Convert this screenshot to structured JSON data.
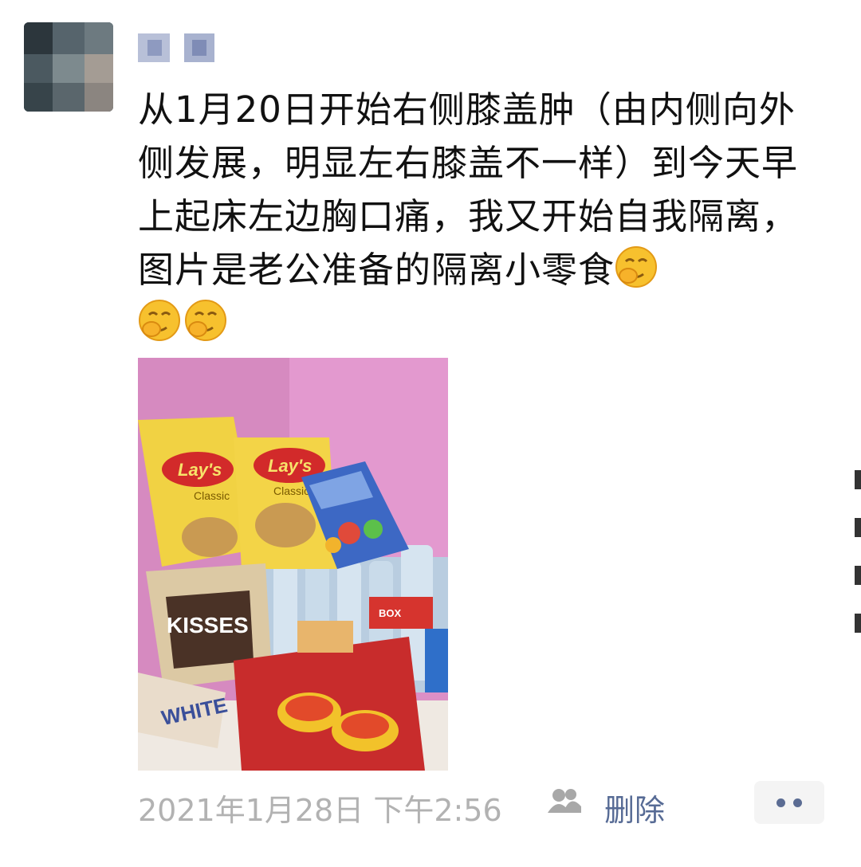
{
  "post": {
    "text": "从1月20日开始右侧膝盖肿（由内侧向外侧发展，明显左右膝盖不一样）到今天早上起床左边胸口痛，我又开始自我隔离，图片是老公准备的隔离小零食",
    "emojis": [
      "facepalm-smile-emoji",
      "facepalm-smile-emoji",
      "facepalm-smile-emoji"
    ],
    "photo_labels": {
      "chips_1": "Lay's",
      "chips_2": "Lay's",
      "chips_sub": "Classic",
      "chocolate": "KISSES",
      "water_label": "BOX",
      "bread": "WHITE"
    }
  },
  "footer": {
    "timestamp": "2021年1月28日 下午2:56",
    "delete_label": "删除"
  },
  "icons": {
    "friends": "friends-visibility-icon",
    "more": "more-dots-icon"
  },
  "colors": {
    "link": "#576b95",
    "timestamp": "#b2b2b2",
    "text": "#111111"
  }
}
